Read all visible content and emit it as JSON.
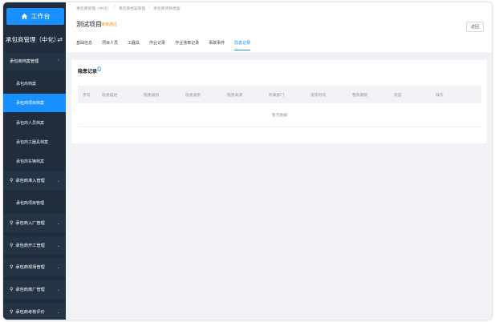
{
  "sidebar": {
    "workbench": "工作台",
    "system_title": "承包商管理（中化）",
    "swap_icon": "⇄",
    "groups": [
      {
        "label": "承包商档案管理",
        "expanded": true
      },
      {
        "label": "承包商准入管理"
      },
      {
        "label": "承包商项目管理"
      },
      {
        "label": "承包商入厂管理"
      },
      {
        "label": "承包商开工管理"
      },
      {
        "label": "承包商现场管理"
      },
      {
        "label": "承包商离厂管理"
      },
      {
        "label": "承包商考核评价"
      }
    ],
    "sub_items": [
      {
        "label": "承包商档案"
      },
      {
        "label": "承包商项目档案",
        "active": true
      },
      {
        "label": "承包商人员档案"
      },
      {
        "label": "承包商工器具档案"
      },
      {
        "label": "承包商车辆档案"
      }
    ]
  },
  "header": {
    "breadcrumb": [
      "承包商管理（中化）",
      "承包商档案管理",
      "承包商项目档案"
    ],
    "title": "测试项目",
    "status": "审核通过",
    "back_label": "返回"
  },
  "tabs": [
    {
      "label": "基础信息"
    },
    {
      "label": "项目人员"
    },
    {
      "label": "工器具"
    },
    {
      "label": "作业记录"
    },
    {
      "label": "作业违章记录"
    },
    {
      "label": "事故事件"
    },
    {
      "label": "隐患记录",
      "active": true
    }
  ],
  "card": {
    "title": "隐患记录",
    "count": "0",
    "columns": [
      "序号",
      "隐患描述",
      "隐患级别",
      "隐患类别",
      "隐患来源",
      "所属部门",
      "发现时间",
      "整改期限",
      "状态",
      "操作"
    ],
    "empty_text": "暂无数据"
  },
  "colors": {
    "sidebar_bg": "#1f2d3d",
    "accent": "#1890ff",
    "status": "#fa8c16"
  }
}
